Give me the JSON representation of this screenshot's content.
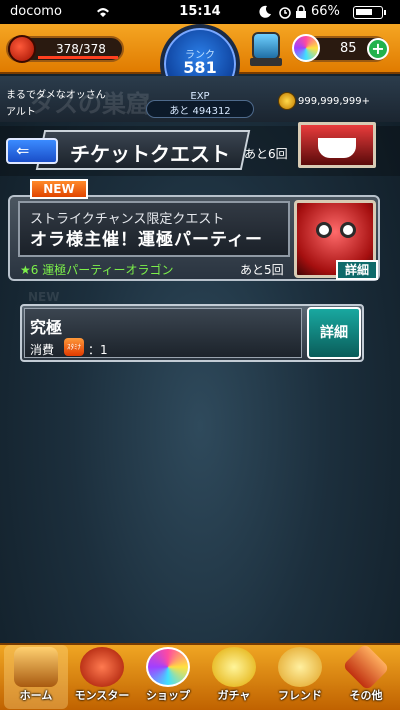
{
  "status_bar": {
    "carrier": "docomo",
    "time": "15:14",
    "battery": "66%"
  },
  "header": {
    "stamina": "378/378",
    "rank_label": "ランク",
    "rank": "581",
    "orbs": "85"
  },
  "subheader": {
    "player_title": "まるでダメなオッさん",
    "player_name": "アルト",
    "area_bg": "タスの巣窟",
    "exp_label": "EXP",
    "exp_remaining": "あと 494312",
    "gold": "999,999,999+"
  },
  "title_bar": {
    "title": "チケットクエスト",
    "remaining": "あと6回"
  },
  "quest_card": {
    "badge": "NEW",
    "subtitle": "ストライクチャンス限定クエスト",
    "title": "オラ様主催！運極パーティー",
    "requirement": "★6 運極パーティーオラゴン",
    "remaining": "あと5回",
    "detail_label": "詳細"
  },
  "ultimate_card": {
    "ghost_badge": "NEW",
    "title": "究極",
    "cost_label": "消費",
    "stamina_icon_text": "ｽﾀﾐﾅ",
    "cost_value": "：1",
    "detail_label": "詳細"
  },
  "bottom_nav": {
    "items": [
      {
        "label": "ホーム",
        "icon": "home-icon",
        "color": "#c5872a"
      },
      {
        "label": "モンスター",
        "icon": "monster-icon",
        "color": "#d4412a"
      },
      {
        "label": "ショップ",
        "icon": "shop-orb-icon",
        "color": "#9a4fff"
      },
      {
        "label": "ガチャ",
        "icon": "gacha-icon",
        "color": "#ffd22a"
      },
      {
        "label": "フレンド",
        "icon": "friend-icon",
        "color": "#ffce4a"
      },
      {
        "label": "その他",
        "icon": "other-icon",
        "color": "#e05030"
      }
    ]
  }
}
